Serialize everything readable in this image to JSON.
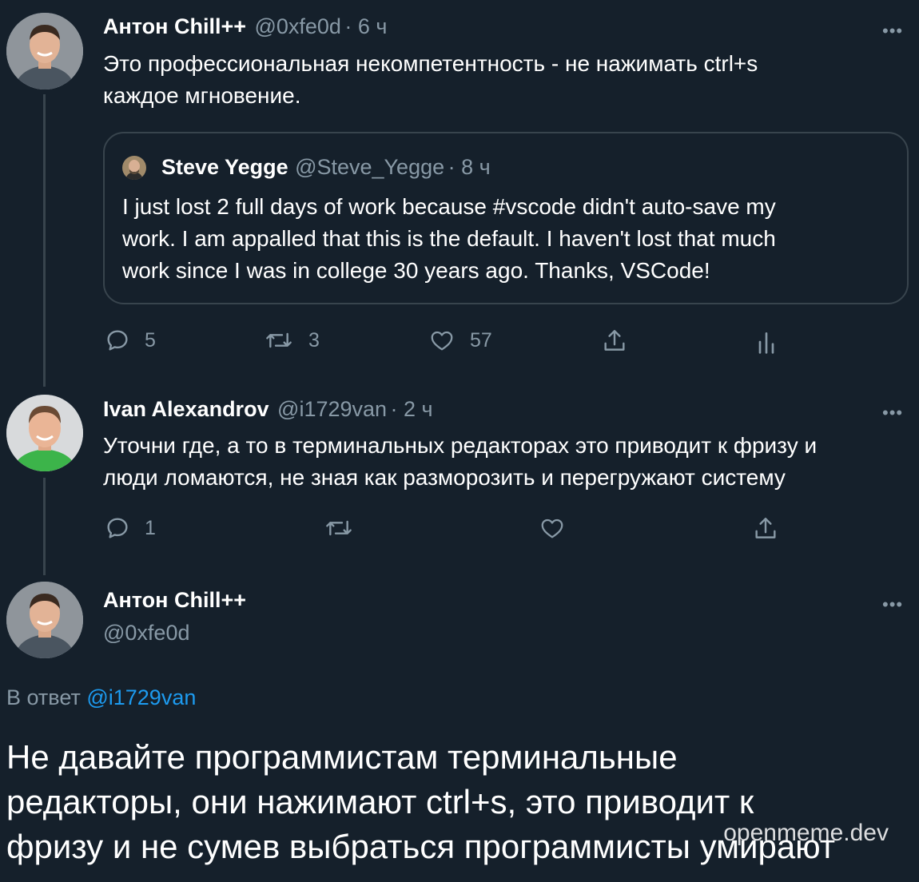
{
  "tweet1": {
    "name": "Антон Chill++",
    "handle": "@0xfe0d",
    "time": "· 6 ч",
    "text_line1": "Это профессиональная некомпетентность - не нажимать ctrl+s",
    "text_line2": "каждое мгновение.",
    "quote": {
      "name": "Steve Yegge",
      "handle": "@Steve_Yegge",
      "time": "· 8 ч",
      "line1": "I just lost 2 full days of work because #vscode didn't auto-save my",
      "line2": "work. I am appalled that this is the default. I haven't lost that much",
      "line3": "work since I was in college 30 years ago. Thanks, VSCode!"
    },
    "counts": {
      "replies": "5",
      "retweets": "3",
      "likes": "57"
    }
  },
  "tweet2": {
    "name": "Ivan Alexandrov",
    "handle": "@i1729van",
    "time": "· 2 ч",
    "text_line1": "Уточни где, а то в терминальных редакторах это приводит к фризу и",
    "text_line2": "люди ломаются, не зная как разморозить и перегружают систему",
    "counts": {
      "replies": "1"
    }
  },
  "tweet3": {
    "name": "Антон Chill++",
    "handle": "@0xfe0d",
    "reply_prefix": "В ответ",
    "reply_to": "@i1729van",
    "line1": "Не давайте программистам терминальные",
    "line2": "редакторы, они нажимают ctrl+s, это приводит к",
    "line3": "фризу и не сумев выбраться программисты умирают"
  },
  "more_glyph": "•••",
  "watermark": "openmeme.dev",
  "icons": [
    "reply-icon",
    "retweet-icon",
    "like-icon",
    "share-icon",
    "analytics-icon",
    "more-icon"
  ],
  "colors": {
    "background": "#15202b",
    "muted": "#8899a6",
    "link": "#1d9bf0",
    "border": "#38444d"
  }
}
